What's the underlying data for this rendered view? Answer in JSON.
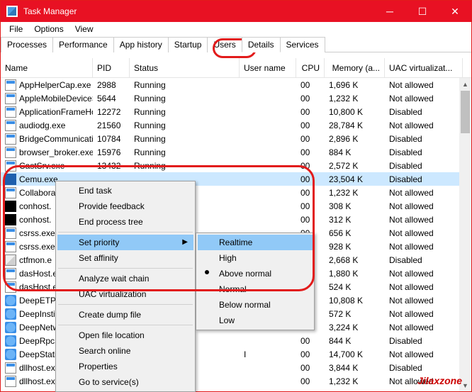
{
  "window": {
    "title": "Task Manager"
  },
  "menu": {
    "file": "File",
    "options": "Options",
    "view": "View"
  },
  "tabs": {
    "processes": "Processes",
    "performance": "Performance",
    "apphistory": "App history",
    "startup": "Startup",
    "users": "Users",
    "details": "Details",
    "services": "Services"
  },
  "columns": {
    "name": "Name",
    "pid": "PID",
    "status": "Status",
    "user": "User name",
    "cpu": "CPU",
    "mem": "Memory (a...",
    "uac": "UAC virtualizat..."
  },
  "rows": [
    {
      "icon": "app",
      "name": "AppHelperCap.exe",
      "pid": "2988",
      "status": "Running",
      "user": "",
      "cpu": "00",
      "mem": "1,696 K",
      "uac": "Not allowed"
    },
    {
      "icon": "app",
      "name": "AppleMobileDeviceS...",
      "pid": "5644",
      "status": "Running",
      "user": "",
      "cpu": "00",
      "mem": "1,232 K",
      "uac": "Not allowed"
    },
    {
      "icon": "app",
      "name": "ApplicationFrameHo...",
      "pid": "12272",
      "status": "Running",
      "user": "",
      "cpu": "00",
      "mem": "10,800 K",
      "uac": "Disabled"
    },
    {
      "icon": "app",
      "name": "audiodg.exe",
      "pid": "21560",
      "status": "Running",
      "user": "",
      "cpu": "00",
      "mem": "28,784 K",
      "uac": "Not allowed"
    },
    {
      "icon": "app",
      "name": "BridgeCommunicati...",
      "pid": "10784",
      "status": "Running",
      "user": "",
      "cpu": "00",
      "mem": "2,896 K",
      "uac": "Disabled"
    },
    {
      "icon": "app",
      "name": "browser_broker.exe",
      "pid": "15976",
      "status": "Running",
      "user": "",
      "cpu": "00",
      "mem": "884 K",
      "uac": "Disabled"
    },
    {
      "icon": "app",
      "name": "CastSrv.exe",
      "pid": "13432",
      "status": "Running",
      "user": "",
      "cpu": "00",
      "mem": "2,572 K",
      "uac": "Disabled"
    },
    {
      "icon": "cemu",
      "name": "Cemu.exe",
      "pid": "",
      "status": "",
      "user": "",
      "cpu": "00",
      "mem": "23,504 K",
      "uac": "Disabled",
      "selected": true
    },
    {
      "icon": "app",
      "name": "Collabora",
      "pid": "",
      "status": "",
      "user": "",
      "cpu": "00",
      "mem": "1,232 K",
      "uac": "Not allowed"
    },
    {
      "icon": "cmd",
      "name": "conhost.",
      "pid": "",
      "status": "",
      "user": "",
      "cpu": "00",
      "mem": "308 K",
      "uac": "Not allowed"
    },
    {
      "icon": "cmd",
      "name": "conhost.",
      "pid": "",
      "status": "",
      "user": "",
      "cpu": "00",
      "mem": "312 K",
      "uac": "Not allowed"
    },
    {
      "icon": "app",
      "name": "csrss.exe",
      "pid": "",
      "status": "",
      "user": "",
      "cpu": "00",
      "mem": "656 K",
      "uac": "Not allowed"
    },
    {
      "icon": "app",
      "name": "csrss.exe",
      "pid": "",
      "status": "",
      "user": "",
      "cpu": "00",
      "mem": "928 K",
      "uac": "Not allowed"
    },
    {
      "icon": "ctf",
      "name": "ctfmon.e",
      "pid": "",
      "status": "",
      "user": "",
      "cpu": "00",
      "mem": "2,668 K",
      "uac": "Disabled"
    },
    {
      "icon": "app",
      "name": "dasHost.e",
      "pid": "",
      "status": "",
      "user": "",
      "cpu": "00",
      "mem": "1,880 K",
      "uac": "Not allowed"
    },
    {
      "icon": "app",
      "name": "dasHost.e",
      "pid": "",
      "status": "",
      "user": "",
      "cpu": "00",
      "mem": "524 K",
      "uac": "Not allowed"
    },
    {
      "icon": "shield",
      "name": "DeepETPS",
      "pid": "",
      "status": "",
      "user": "",
      "cpu": "00",
      "mem": "10,808 K",
      "uac": "Not allowed"
    },
    {
      "icon": "shield",
      "name": "DeepInsti",
      "pid": "",
      "status": "",
      "user": "",
      "cpu": "00",
      "mem": "572 K",
      "uac": "Not allowed"
    },
    {
      "icon": "shield",
      "name": "DeepNetw",
      "pid": "",
      "status": "",
      "user": "",
      "cpu": "00",
      "mem": "3,224 K",
      "uac": "Not allowed"
    },
    {
      "icon": "shield",
      "name": "DeepRpcS",
      "pid": "",
      "status": "",
      "user": "",
      "cpu": "00",
      "mem": "844 K",
      "uac": "Disabled"
    },
    {
      "icon": "shield",
      "name": "DeepStati",
      "pid": "",
      "status": "",
      "user": "I",
      "cpu": "00",
      "mem": "14,700 K",
      "uac": "Not allowed"
    },
    {
      "icon": "app",
      "name": "dllhost.ex",
      "pid": "",
      "status": "",
      "user": "",
      "cpu": "00",
      "mem": "3,844 K",
      "uac": "Disabled"
    },
    {
      "icon": "app",
      "name": "dllhost.ex",
      "pid": "",
      "status": "",
      "user": "",
      "cpu": "00",
      "mem": "1,232 K",
      "uac": "Not allowed"
    }
  ],
  "context": {
    "end_task": "End task",
    "provide_feedback": "Provide feedback",
    "end_tree": "End process tree",
    "set_priority": "Set priority",
    "set_affinity": "Set affinity",
    "analyze": "Analyze wait chain",
    "uac_virt": "UAC virtualization",
    "create_dump": "Create dump file",
    "open_loc": "Open file location",
    "search_online": "Search online",
    "properties": "Properties",
    "go_to_services": "Go to service(s)"
  },
  "priority": {
    "realtime": "Realtime",
    "high": "High",
    "above_normal": "Above normal",
    "normal": "Normal",
    "below_normal": "Below normal",
    "low": "Low"
  },
  "watermark": "Jilaxzone"
}
